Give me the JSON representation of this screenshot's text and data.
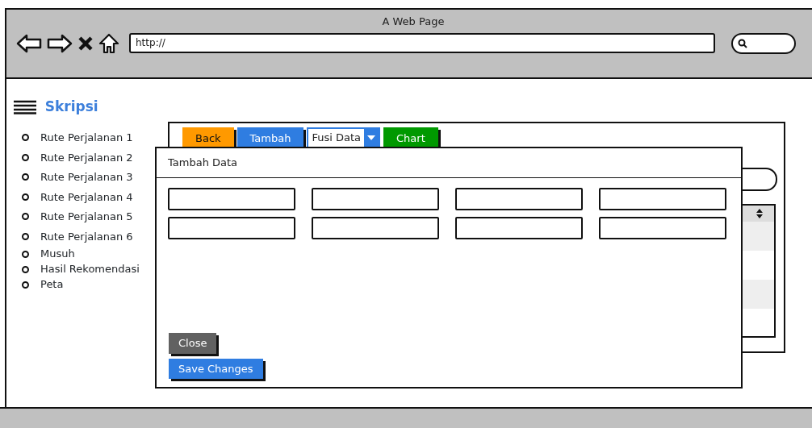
{
  "browser": {
    "title": "A Web Page",
    "url": "http://"
  },
  "sidebar": {
    "title": "Skripsi",
    "items": [
      {
        "label": "Rute Perjalanan 1"
      },
      {
        "label": "Rute Perjalanan 2"
      },
      {
        "label": "Rute Perjalanan 3"
      },
      {
        "label": "Rute Perjalanan 4"
      },
      {
        "label": "Rute Perjalanan 5"
      },
      {
        "label": "Rute Perjalanan 6"
      },
      {
        "label": "Musuh"
      },
      {
        "label": "Hasil Rekomendasi"
      },
      {
        "label": "Peta"
      }
    ]
  },
  "toolbar": {
    "items": [
      {
        "kind": "button",
        "label": "Back",
        "color": "#ff9900"
      },
      {
        "kind": "button",
        "label": "Tambah",
        "color": "#2f7de1"
      },
      {
        "kind": "dropdown",
        "label": "Fusi Data"
      },
      {
        "kind": "button",
        "label": "Chart",
        "color": "#009900"
      }
    ]
  },
  "modal": {
    "title": "Tambah Data",
    "fields": [
      {
        "kind": "input"
      },
      {
        "kind": "input"
      },
      {
        "kind": "input"
      },
      {
        "kind": "input"
      },
      {
        "kind": "input"
      },
      {
        "kind": "input"
      },
      {
        "kind": "input"
      },
      {
        "kind": "input"
      }
    ],
    "buttons": [
      {
        "label": "Close",
        "kind": "secondary"
      },
      {
        "label": "Save Changes",
        "kind": "primary"
      }
    ]
  }
}
